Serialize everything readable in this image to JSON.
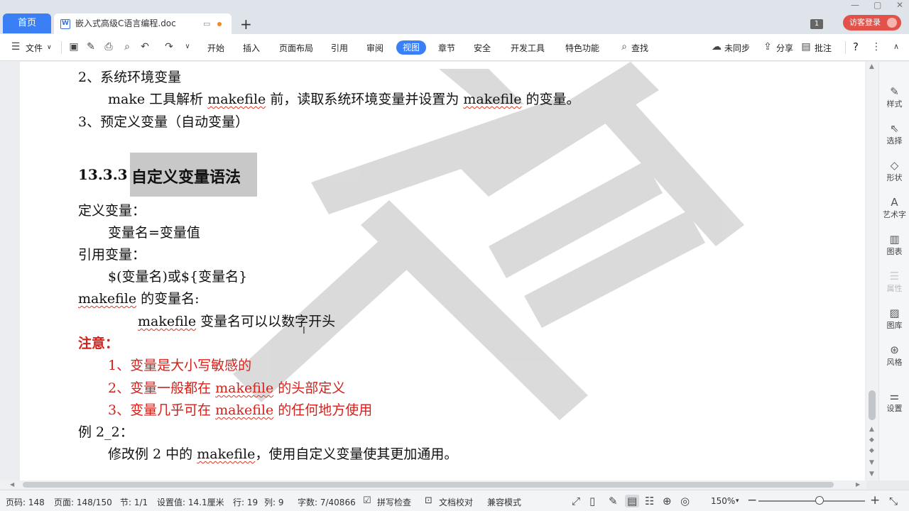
{
  "tabs": {
    "home": "首页",
    "doc_title": "嵌入式高级C语言编程.doc",
    "add": "+"
  },
  "window": {
    "badge": "1",
    "login": "访客登录"
  },
  "menu": {
    "file": "文件",
    "items": [
      "开始",
      "插入",
      "页面布局",
      "引用",
      "审阅",
      "视图",
      "章节",
      "安全",
      "开发工具",
      "特色功能"
    ],
    "search": "查找",
    "sync": "未同步",
    "share": "分享",
    "comment": "批注",
    "help": "?"
  },
  "document": {
    "line1": "2、系统环境变量",
    "line2_a": "make 工具解析 ",
    "line2_b": "makefile",
    "line2_c": " 前，读取系统环境变量并设置为 ",
    "line2_d": "makefile",
    "line2_e": " 的变量。",
    "line3": "3、预定义变量（自动变量）",
    "heading_num": "13.3.3",
    "heading_text": "自定义变量语法",
    "def_title": "定义变量：",
    "def_body": "变量名=变量值",
    "ref_title": "引用变量：",
    "ref_body": "$(变量名)或${变量名}",
    "mk_title_a": "makefile",
    "mk_title_b": " 的变量名:",
    "mk_body_a": "makefile",
    "mk_body_b": " 变量名可以以数字开头",
    "note_title": "注意：",
    "note1": "1、变量是大小写敏感的",
    "note2_a": "2、变量一般都在 ",
    "note2_b": "makefile",
    "note2_c": " 的头部定义",
    "note3_a": "3、变量几乎可在 ",
    "note3_b": "makefile",
    "note3_c": " 的任何地方使用",
    "example": "例 2_2：",
    "example_body_a": "修改例 2 中的 ",
    "example_body_b": "makefile",
    "example_body_c": "，使用自定义变量使其更加通用。"
  },
  "rightpanel": [
    "样式",
    "选择",
    "形状",
    "艺术字",
    "图表",
    "属性",
    "图库",
    "风格",
    "设置"
  ],
  "status": {
    "page": "页码: 148",
    "pages": "页面: 148/150",
    "section": "节: 1/1",
    "setting": "设置值: 14.1厘米",
    "row": "行: 19",
    "col": "列: 9",
    "words": "字数: 7/40866",
    "spell": "拼写检查",
    "proof": "文档校对",
    "compat": "兼容模式",
    "zoom": "150%"
  },
  "colors": {
    "accent": "#3a7ff5",
    "login": "#e2524a",
    "note_red": "#d6201a",
    "heading_bg": "#c8c8c8"
  }
}
